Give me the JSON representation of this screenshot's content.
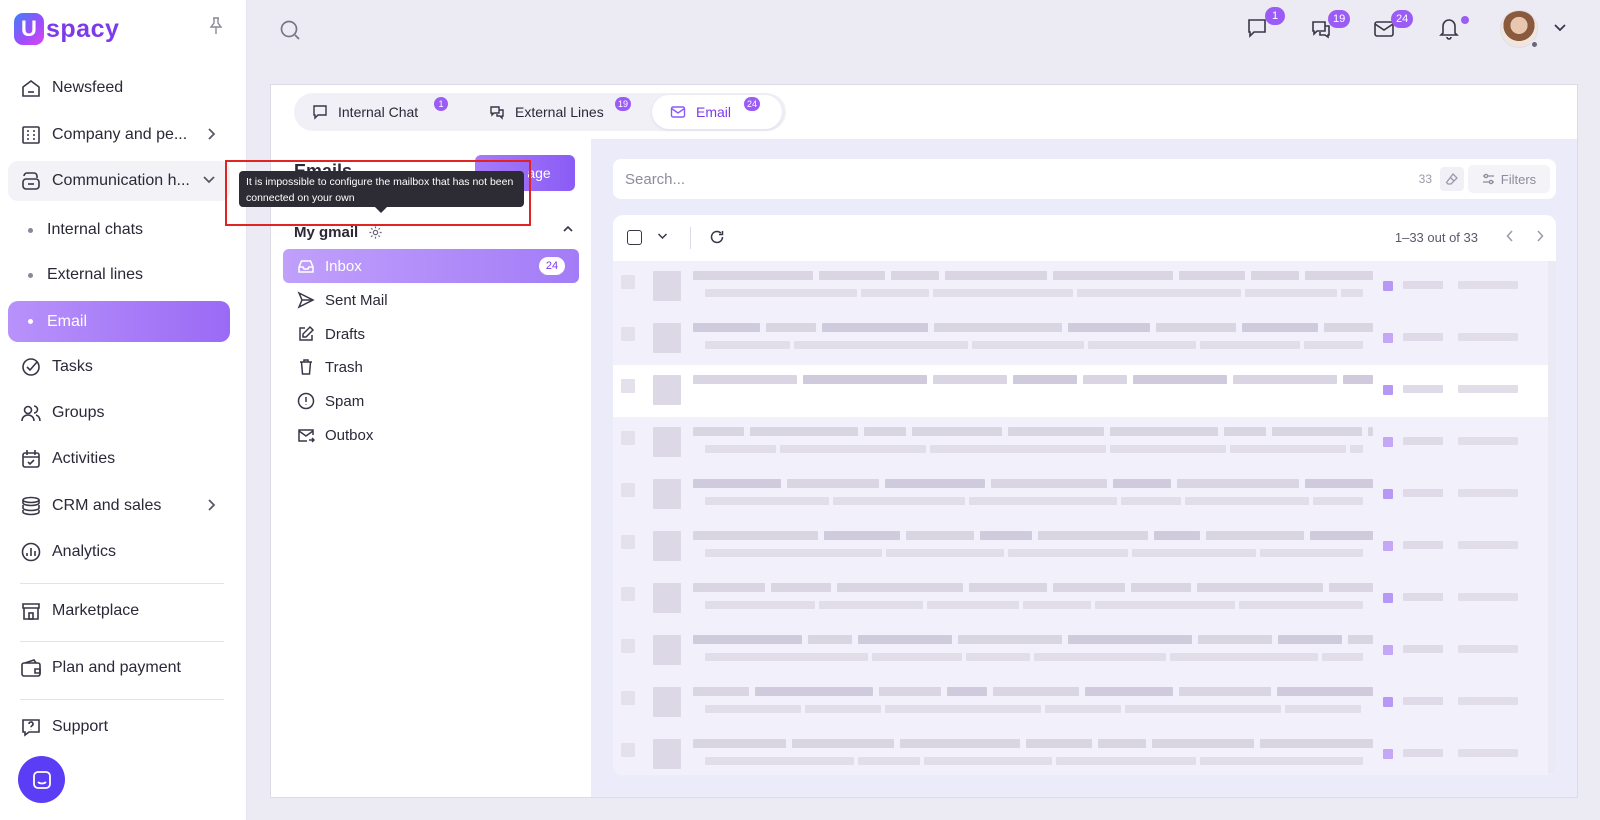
{
  "brand": {
    "logo_letter": "U",
    "logo_text": "spacy"
  },
  "sidebar": {
    "items": [
      {
        "label": "Newsfeed",
        "icon": "home-icon"
      },
      {
        "label": "Company and pe...",
        "icon": "building-icon"
      },
      {
        "label": "Communication h...",
        "icon": "communication-icon"
      },
      {
        "label": "Tasks",
        "icon": "check-circle-icon"
      },
      {
        "label": "Groups",
        "icon": "users-icon"
      },
      {
        "label": "Activities",
        "icon": "calendar-icon"
      },
      {
        "label": "CRM and sales",
        "icon": "funnel-icon"
      },
      {
        "label": "Analytics",
        "icon": "chart-icon"
      },
      {
        "label": "Marketplace",
        "icon": "store-icon"
      },
      {
        "label": "Plan and payment",
        "icon": "wallet-icon"
      },
      {
        "label": "Support",
        "icon": "help-icon"
      }
    ],
    "sub_items": [
      {
        "label": "Internal chats"
      },
      {
        "label": "External lines"
      },
      {
        "label": "Email"
      }
    ]
  },
  "topbar": {
    "badges": {
      "chat": "1",
      "external": "19",
      "mail": "24"
    }
  },
  "tabs": [
    {
      "label": "Internal Chat",
      "badge": "1"
    },
    {
      "label": "External Lines",
      "badge": "19"
    },
    {
      "label": "Email",
      "badge": "24"
    }
  ],
  "left_panel": {
    "new_message_label": "age",
    "mailbox_name": "My gmail",
    "folders": [
      {
        "label": "Inbox",
        "count": "24"
      },
      {
        "label": "Sent Mail"
      },
      {
        "label": "Drafts"
      },
      {
        "label": "Trash"
      },
      {
        "label": "Spam"
      },
      {
        "label": "Outbox"
      }
    ]
  },
  "tooltip": {
    "text": "It is impossible to configure the mailbox that has not been connected on your own"
  },
  "right_panel": {
    "search_placeholder": "Search...",
    "search_count": "33",
    "filters_label": "Filters",
    "pager": "1–33 out of 33"
  },
  "colors": {
    "accent": "#8b5cf6",
    "highlight": "#e02424",
    "fab": "#5b3df5"
  }
}
